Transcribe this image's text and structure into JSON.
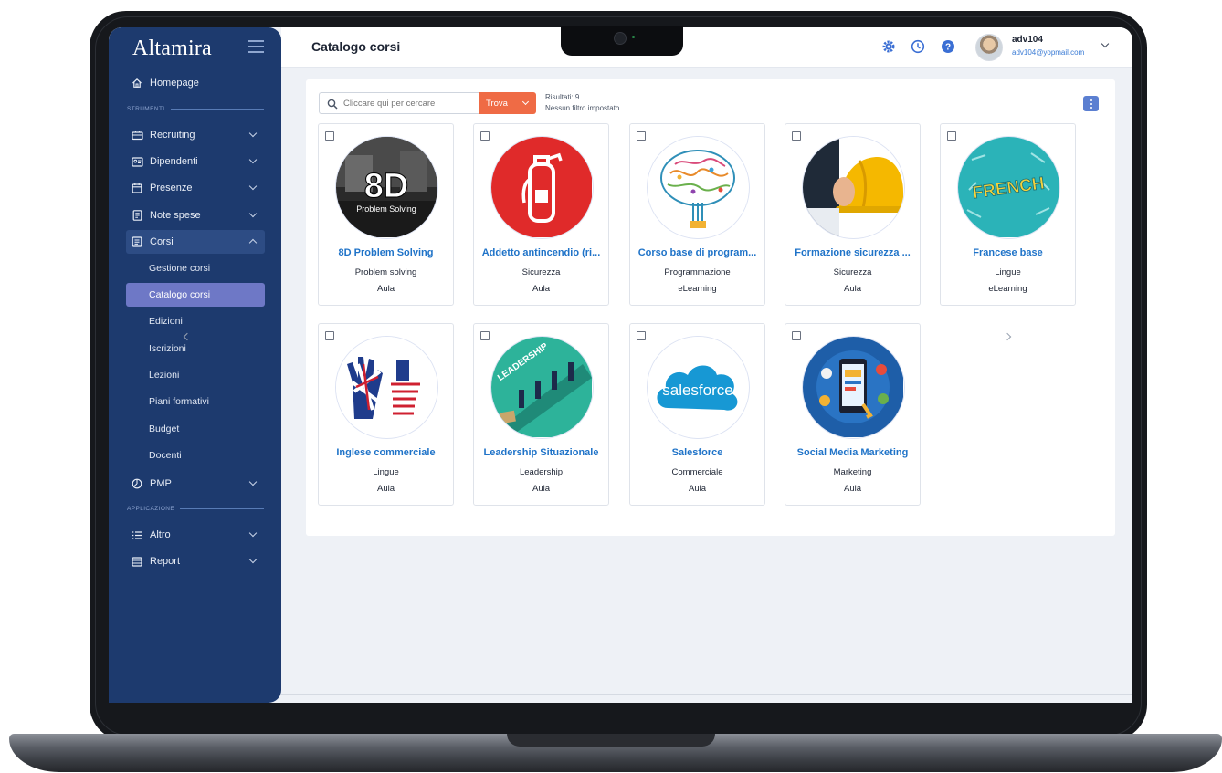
{
  "app": {
    "logo": "Altamira",
    "page_title": "Catalogo corsi"
  },
  "user": {
    "name": "adv104",
    "email": "adv104@yopmail.com"
  },
  "header_icons": [
    "gear-icon",
    "clock-icon",
    "help-icon"
  ],
  "sidebar": {
    "homepage": "Homepage",
    "section_strumenti": "STRUMENTI",
    "items": [
      {
        "label": "Recruiting",
        "icon": "briefcase-icon"
      },
      {
        "label": "Dipendenti",
        "icon": "id-card-icon"
      },
      {
        "label": "Presenze",
        "icon": "calendar-icon"
      },
      {
        "label": "Note spese",
        "icon": "receipt-icon"
      },
      {
        "label": "Corsi",
        "icon": "book-icon"
      }
    ],
    "corsi_sub": [
      "Gestione corsi",
      "Catalogo corsi",
      "Edizioni",
      "Iscrizioni",
      "Lezioni",
      "Piani formativi",
      "Budget",
      "Docenti"
    ],
    "pmp": "PMP",
    "section_applicazione": "APPLICAZIONE",
    "altro": "Altro",
    "report": "Report"
  },
  "search": {
    "placeholder": "Cliccare qui per cercare",
    "button": "Trova"
  },
  "results": {
    "count": "Risultati: 9",
    "filter": "Nessun filtro impostato"
  },
  "courses": [
    {
      "title": "8D Problem Solving",
      "category": "Problem solving",
      "mode": "Aula",
      "thumb_text": "8D",
      "thumb_sub": "Problem Solving"
    },
    {
      "title": "Addetto antincendio (ri...",
      "category": "Sicurezza",
      "mode": "Aula"
    },
    {
      "title": "Corso base di program...",
      "category": "Programmazione",
      "mode": "eLearning"
    },
    {
      "title": "Formazione sicurezza ...",
      "category": "Sicurezza",
      "mode": "Aula"
    },
    {
      "title": "Francese base",
      "category": "Lingue",
      "mode": "eLearning",
      "thumb_text": "FRENCH"
    },
    {
      "title": "Inglese commerciale",
      "category": "Lingue",
      "mode": "Aula"
    },
    {
      "title": "Leadership Situazionale",
      "category": "Leadership",
      "mode": "Aula",
      "thumb_text": "LEADERSHIP"
    },
    {
      "title": "Salesforce",
      "category": "Commerciale",
      "mode": "Aula",
      "thumb_text": "salesforce"
    },
    {
      "title": "Social Media Marketing",
      "category": "Marketing",
      "mode": "Aula"
    }
  ],
  "colors": {
    "sidebar": "#1d3a6e",
    "accent": "#ef6b45",
    "link": "#1f73c8",
    "active": "#6e78c6"
  }
}
